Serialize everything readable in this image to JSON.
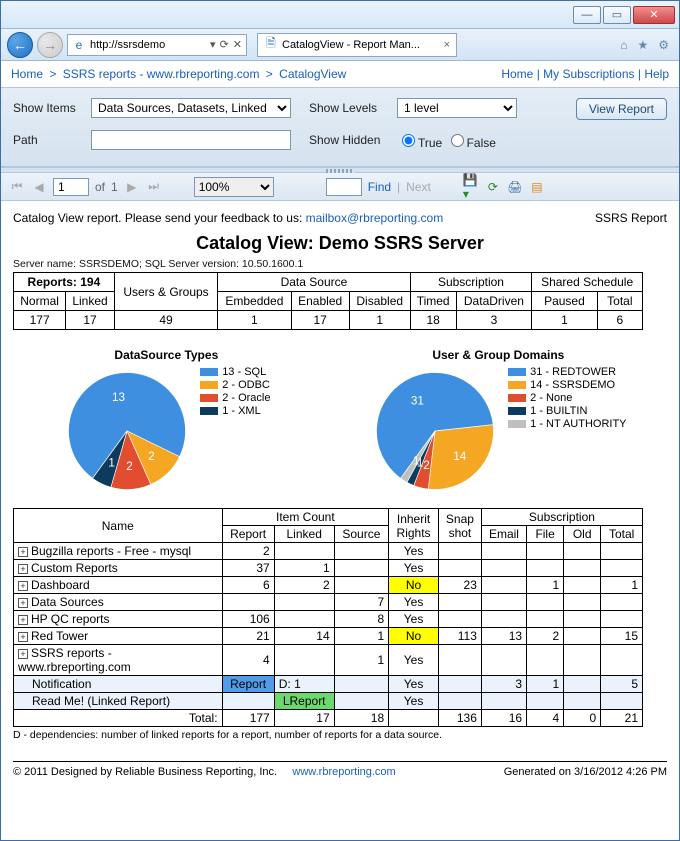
{
  "window": {
    "minimize": "—",
    "maximize": "▭",
    "close": "✕"
  },
  "browser": {
    "url": "http://ssrsdemo",
    "tab_title": "CatalogView - Report Man...",
    "home_icon": "⌂",
    "star_icon": "★",
    "gear_icon": "⚙"
  },
  "breadcrumb": {
    "left": [
      "Home",
      "SSRS reports - www.rbreporting.com",
      "CatalogView"
    ],
    "right": [
      "Home",
      "My Subscriptions",
      "Help"
    ]
  },
  "params": {
    "show_items_label": "Show Items",
    "show_items_value": "Data Sources, Datasets, Linked",
    "path_label": "Path",
    "path_value": "",
    "show_levels_label": "Show Levels",
    "show_levels_value": "1 level",
    "show_hidden_label": "Show Hidden",
    "radio_true": "True",
    "radio_false": "False",
    "view_report_btn": "View Report"
  },
  "rv_toolbar": {
    "page_current": "1",
    "of_label": "of",
    "page_total": "1",
    "zoom": "100%",
    "find_label": "Find",
    "next_label": "Next"
  },
  "report": {
    "feedback_left": "Catalog View report. Please send your feedback to us: ",
    "feedback_email": "mailbox@rbreporting.com",
    "feedback_right": "SSRS Report",
    "title": "Catalog View: Demo SSRS Server",
    "server_line": "Server name: SSRSDEMO; SQL Server version: 10.50.1600.1",
    "stats": {
      "reports_hdr": "Reports: 194",
      "users_groups_hdr": "Users & Groups",
      "datasource_hdr": "Data Source",
      "subscription_hdr": "Subscription",
      "schedule_hdr": "Shared Schedule",
      "cols": [
        "Normal",
        "Linked",
        "",
        "Embedded",
        "Enabled",
        "Disabled",
        "Timed",
        "DataDriven",
        "Paused",
        "Total"
      ],
      "vals": [
        "177",
        "17",
        "49",
        "1",
        "17",
        "1",
        "18",
        "3",
        "1",
        "6"
      ]
    },
    "chart1_title": "DataSource Types",
    "chart2_title": "User & Group Domains",
    "detail": {
      "h_name": "Name",
      "h_item_count": "Item Count",
      "h_inherit": "Inherit Rights",
      "h_snap": "Snap shot",
      "h_sub": "Subscription",
      "h_report": "Report",
      "h_linked": "Linked",
      "h_source": "Source",
      "h_email": "Email",
      "h_file": "File",
      "h_old": "Old",
      "h_total": "Total",
      "rows": [
        {
          "name": "Bugzilla reports - Free - mysql",
          "r": "2",
          "l": "",
          "s": "",
          "ih": "Yes",
          "sn": "",
          "e": "",
          "f": "",
          "o": "",
          "t": ""
        },
        {
          "name": "Custom Reports",
          "r": "37",
          "l": "1",
          "s": "",
          "ih": "Yes",
          "sn": "",
          "e": "",
          "f": "",
          "o": "",
          "t": ""
        },
        {
          "name": "Dashboard",
          "r": "6",
          "l": "2",
          "s": "",
          "ih": "No",
          "ih_hl": true,
          "sn": "23",
          "e": "",
          "f": "1",
          "o": "",
          "t": "1"
        },
        {
          "name": "Data Sources",
          "r": "",
          "l": "",
          "s": "7",
          "ih": "Yes",
          "sn": "",
          "e": "",
          "f": "",
          "o": "",
          "t": ""
        },
        {
          "name": "HP QC reports",
          "r": "106",
          "l": "",
          "s": "8",
          "ih": "Yes",
          "sn": "",
          "e": "",
          "f": "",
          "o": "",
          "t": ""
        },
        {
          "name": "Red Tower",
          "r": "21",
          "l": "14",
          "s": "1",
          "ih": "No",
          "ih_hl": true,
          "sn": "113",
          "e": "13",
          "f": "2",
          "o": "",
          "t": "15"
        },
        {
          "name": "SSRS reports - www.rbreporting.com",
          "r": "4",
          "l": "",
          "s": "1",
          "ih": "Yes",
          "sn": "",
          "e": "",
          "f": "",
          "o": "",
          "t": ""
        }
      ],
      "sub1": {
        "name": "Notification",
        "r": "Report",
        "l": "D: 1",
        "s": "",
        "ih": "Yes",
        "sn": "",
        "e": "3",
        "f": "1",
        "o": "",
        "t": "5"
      },
      "sub2": {
        "name": "Read Me! (Linked Report)",
        "r": "",
        "l": "LReport",
        "s": "",
        "ih": "Yes",
        "sn": "",
        "e": "",
        "f": "",
        "o": "",
        "t": ""
      },
      "total_label": "Total:",
      "totals": {
        "r": "177",
        "l": "17",
        "s": "18",
        "ih": "",
        "sn": "136",
        "e": "16",
        "f": "4",
        "o": "0",
        "t": "21"
      }
    },
    "footnote": "D - dependencies: number of linked reports for a report, number of reports for a data source.",
    "footer_left": "© 2011 Designed by Reliable Business Reporting, Inc.",
    "footer_link": "www.rbreporting.com",
    "footer_right": "Generated on 3/16/2012 4:26 PM"
  },
  "chart_data": [
    {
      "type": "pie",
      "title": "DataSource Types",
      "series": [
        {
          "name": "SQL",
          "value": 13,
          "label": "13 - SQL",
          "color": "#3f8fe0"
        },
        {
          "name": "ODBC",
          "value": 2,
          "label": "2 - ODBC",
          "color": "#f5a623"
        },
        {
          "name": "Oracle",
          "value": 2,
          "label": "2 - Oracle",
          "color": "#e14d2f"
        },
        {
          "name": "XML",
          "value": 1,
          "label": "1 - XML",
          "color": "#0d3b5e"
        }
      ]
    },
    {
      "type": "pie",
      "title": "User & Group Domains",
      "series": [
        {
          "name": "REDTOWER",
          "value": 31,
          "label": "31 - REDTOWER",
          "color": "#3f8fe0"
        },
        {
          "name": "SSRSDEMO",
          "value": 14,
          "label": "14 - SSRSDEMO",
          "color": "#f5a623"
        },
        {
          "name": "None",
          "value": 2,
          "label": "2 - None",
          "color": "#e14d2f"
        },
        {
          "name": "BUILTIN",
          "value": 1,
          "label": "1 - BUILTIN",
          "color": "#0d3b5e"
        },
        {
          "name": "NT AUTHORITY",
          "value": 1,
          "label": "1 - NT AUTHORITY",
          "color": "#bfbfbf"
        }
      ]
    }
  ]
}
